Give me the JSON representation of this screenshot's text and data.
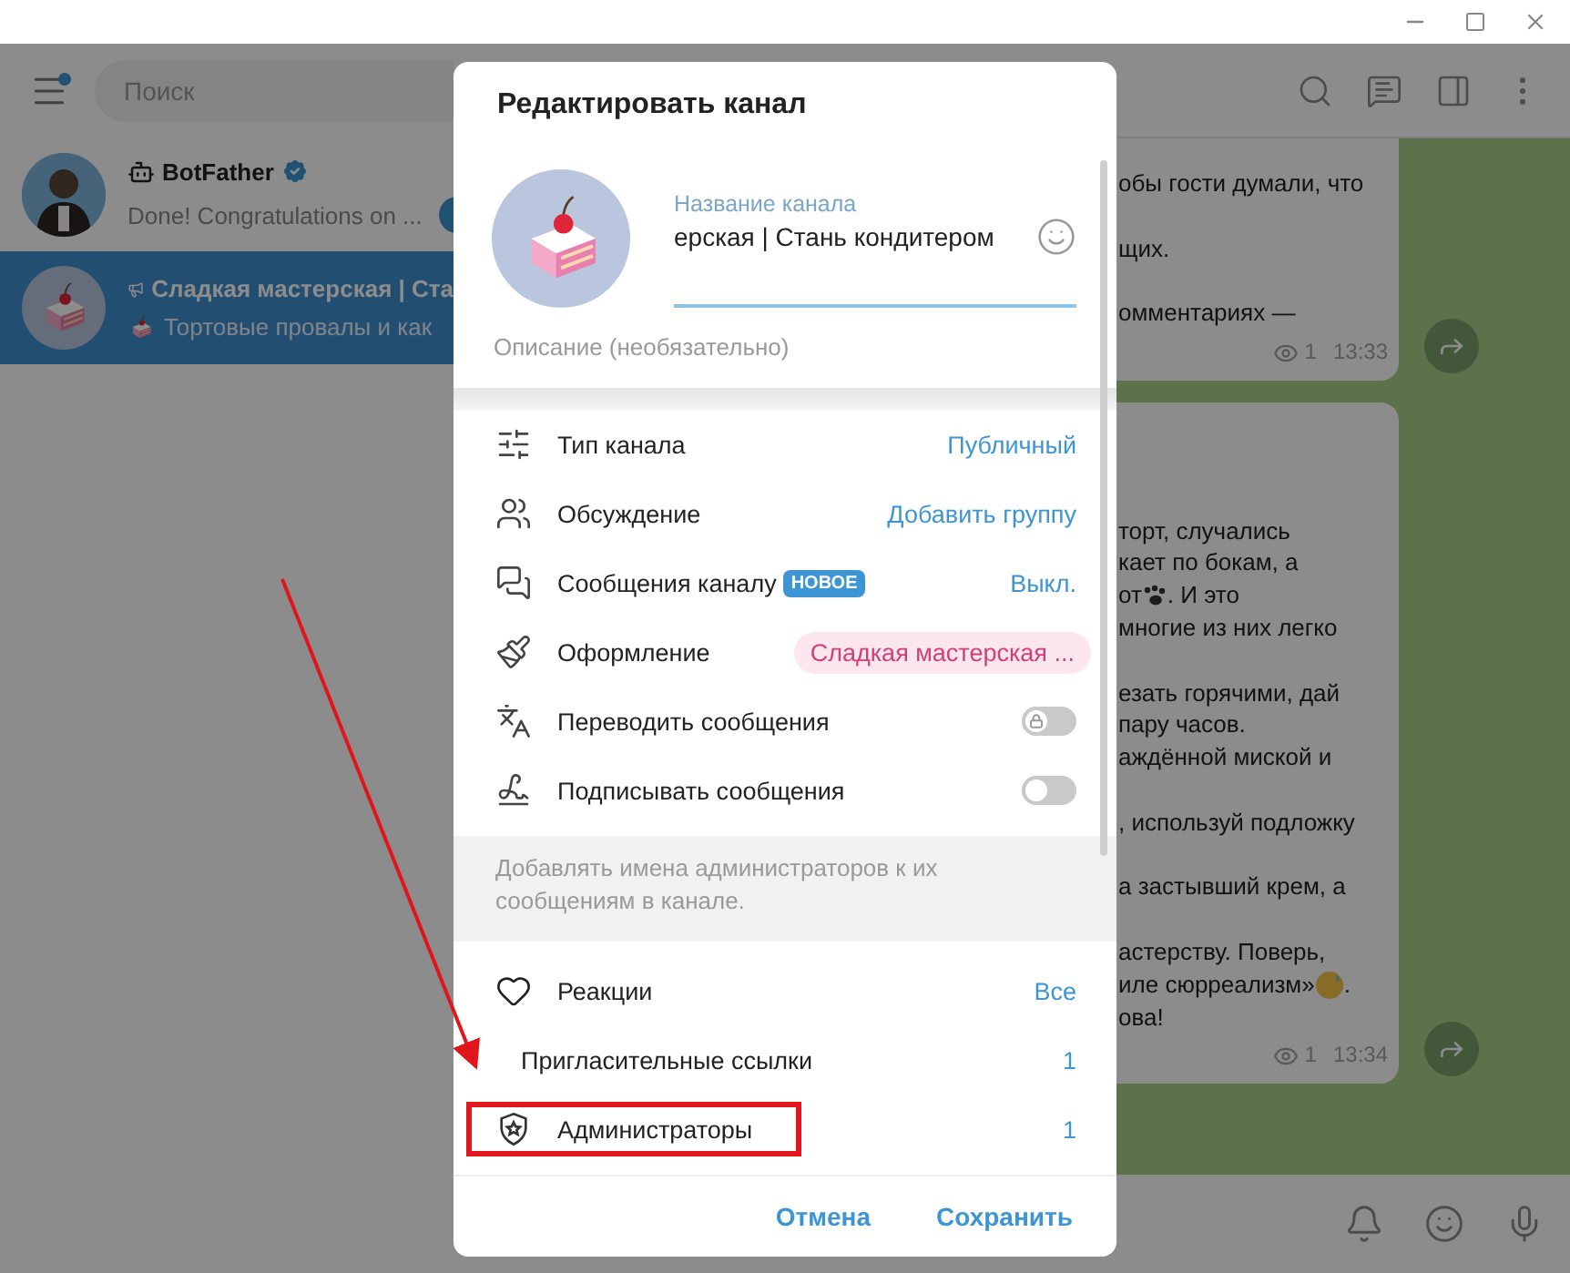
{
  "sidebar": {
    "menu": {
      "unread": true
    },
    "search": {
      "placeholder": "Поиск"
    },
    "chats": [
      {
        "kind": "bot",
        "name": "BotFather",
        "verified": true,
        "preview": "Done! Congratulations on ...",
        "preview_icon": false,
        "unread": true,
        "selected": false
      },
      {
        "kind": "channel",
        "name": "Сладкая мастерская | Ста",
        "verified": false,
        "preview": "Тортовые провалы и как",
        "preview_icon": true,
        "unread": false,
        "selected": true
      }
    ]
  },
  "messages": [
    {
      "paragraphs": [
        [
          {
            "text": "обы гости думали, что"
          }
        ],
        [
          {
            "text": "щих."
          }
        ],
        [
          {
            "text": "омментариях —"
          }
        ]
      ],
      "views": "1",
      "time": "13:33"
    },
    {
      "paragraphs": [
        [
          {
            "text": "торт, случались"
          },
          {
            "text": "кает по бокам, а"
          },
          {
            "kind": "paw",
            "text": "от ",
            "after": ". И это"
          },
          {
            "text": "многие из них легко"
          }
        ],
        [
          {
            "text": "езать горячими, дай"
          },
          {
            "text": "пару часов."
          },
          {
            "text": "аждённой миской и"
          }
        ],
        [
          {
            "text": ", используй подложку"
          }
        ],
        [
          {
            "text": "а застывший крем, а"
          }
        ],
        [
          {
            "text": "астерству. Поверь,"
          },
          {
            "kind": "grin",
            "text": "иле сюрреализм» ",
            "after": "."
          },
          {
            "text": "ова!"
          }
        ]
      ],
      "views": "1",
      "time": "13:34"
    }
  ],
  "dialog": {
    "title": "Редактировать канал",
    "name_field": {
      "label": "Название канала",
      "value": "ерская | Стань кондитером"
    },
    "description": {
      "placeholder": "Описание (необязательно)"
    },
    "settings": [
      {
        "kind": "value",
        "label": "Тип канала",
        "value": "Публичный"
      },
      {
        "kind": "value",
        "label": "Обсуждение",
        "value": "Добавить группу"
      },
      {
        "kind": "value",
        "label": "Сообщения каналу",
        "badge": "НОВОЕ",
        "value": "Выкл."
      },
      {
        "kind": "pill",
        "label": "Оформление",
        "value": "Сладкая мастерская ..."
      },
      {
        "kind": "toggle",
        "label": "Переводить сообщения",
        "on": false,
        "locked": true
      },
      {
        "kind": "toggle",
        "label": "Подписывать сообщения",
        "on": false,
        "locked": false
      }
    ],
    "info": "Добавлять имена администраторов к их сообщениям в канале.",
    "more": [
      {
        "label": "Реакции",
        "value": "Все",
        "highlighted": false
      },
      {
        "label": "Пригласительные ссылки",
        "value": "1",
        "highlighted": false
      },
      {
        "label": "Администраторы",
        "value": "1",
        "highlighted": true
      }
    ],
    "buttons": [
      {
        "label": "Отмена"
      },
      {
        "label": "Сохранить"
      }
    ]
  }
}
